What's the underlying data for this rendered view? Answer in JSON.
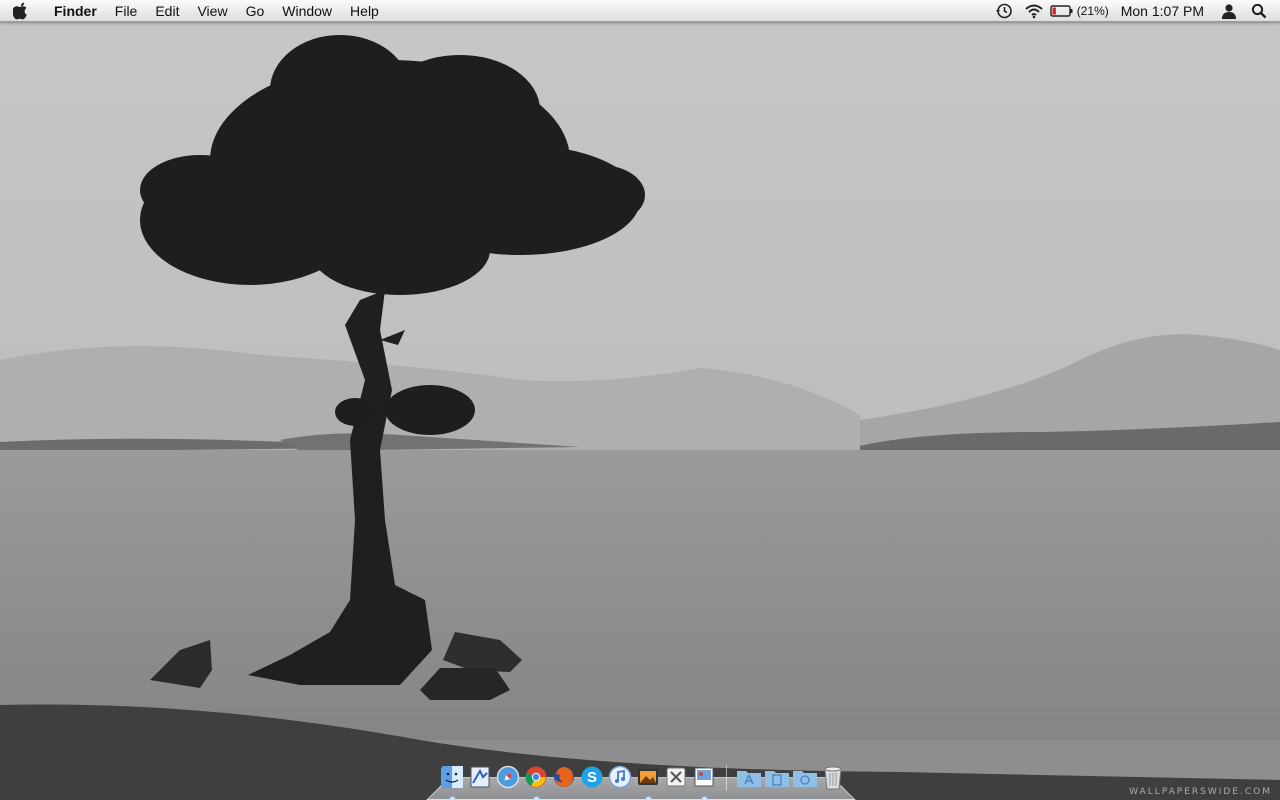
{
  "menubar": {
    "apple_icon": "apple-logo-icon",
    "app_name": "Finder",
    "menus": [
      "File",
      "Edit",
      "View",
      "Go",
      "Window",
      "Help"
    ],
    "status": {
      "time_machine_icon": "time-machine-icon",
      "wifi_icon": "wifi-icon",
      "battery_icon": "battery-icon",
      "battery_percent": "(21%)",
      "battery_level": 0.21,
      "clock": "Mon 1:07 PM",
      "user_icon": "user-icon",
      "spotlight_icon": "spotlight-search-icon"
    }
  },
  "dock": {
    "apps": [
      {
        "name": "finder-icon",
        "running": true
      },
      {
        "name": "preview-icon",
        "running": false
      },
      {
        "name": "safari-icon",
        "running": false
      },
      {
        "name": "chrome-icon",
        "running": true
      },
      {
        "name": "firefox-icon",
        "running": false
      },
      {
        "name": "skype-icon",
        "running": false
      },
      {
        "name": "itunes-icon",
        "running": false
      },
      {
        "name": "iphoto-icon",
        "running": true
      },
      {
        "name": "system-preferences-icon",
        "running": false
      },
      {
        "name": "preview-photos-icon",
        "running": true
      }
    ],
    "stacks": [
      "applications-folder-icon",
      "documents-folder-icon",
      "downloads-folder-icon"
    ],
    "trash": "trash-icon"
  },
  "wallpaper": {
    "description_colors": {
      "sky": "#c8c8c8",
      "water": "#8a8a8a",
      "tree": "#1e1e1e"
    },
    "watermark": "WALLPAPERSWIDE.COM"
  }
}
